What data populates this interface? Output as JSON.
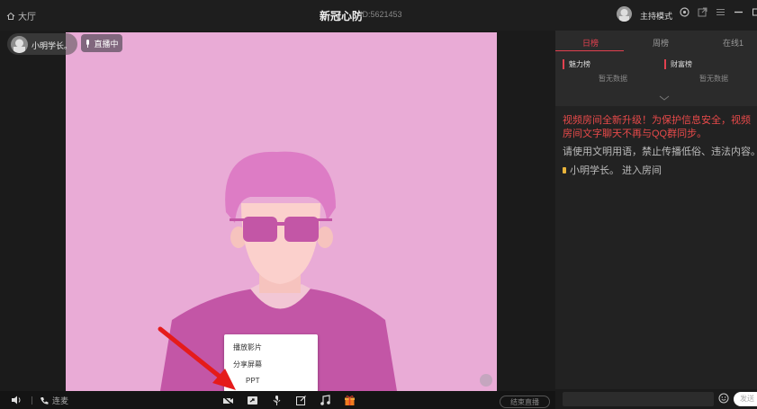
{
  "titlebar": {
    "home_label": "大厅",
    "room_title": "新冠心防",
    "room_id": "ID:5621453",
    "host_mode": "主持模式"
  },
  "streamer": {
    "name": "小明学长。",
    "live_badge": "直播中"
  },
  "popup_menu": {
    "items": [
      "播放影片",
      "分享屏幕",
      "PPT"
    ]
  },
  "bottombar": {
    "call_label": "连麦",
    "end_live_label": "结束直播"
  },
  "rank": {
    "tabs": [
      "日榜",
      "周榜",
      "在线1"
    ],
    "charm_label": "魅力榜",
    "wealth_label": "财富榜",
    "empty_text": "暂无数据"
  },
  "chat": {
    "notice": "视频房间全新升级！为保护信息安全，视频房间文字聊天不再与QQ群同步。",
    "rules": "请使用文明用语，禁止传播低俗、违法内容。",
    "enter_message": "小明学长。 进入房间",
    "send_label": "发送"
  },
  "colors": {
    "accent": "#e2414f",
    "video_bg": "#e9abd6",
    "notice": "#e84a4a"
  }
}
